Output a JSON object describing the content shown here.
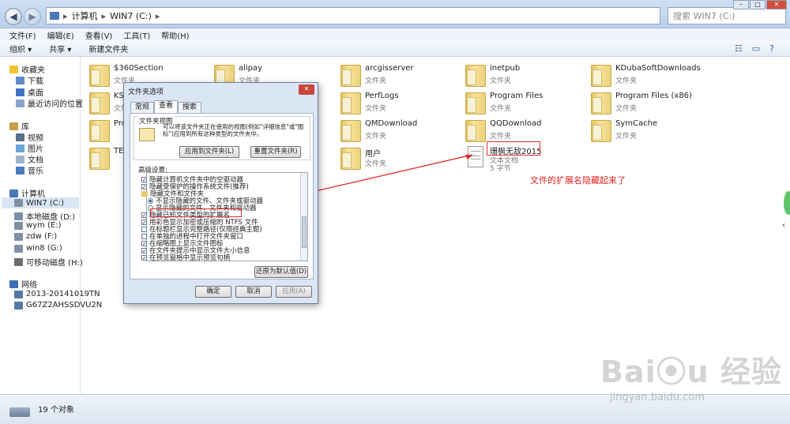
{
  "window": {
    "breadcrumb": [
      "计算机",
      "WIN7 (C:)"
    ],
    "search_placeholder": "搜索 WIN7 (C:)"
  },
  "menubar": [
    "文件(F)",
    "编辑(E)",
    "查看(V)",
    "工具(T)",
    "帮助(H)"
  ],
  "toolbar": {
    "organize": "组织 ▾",
    "share": "共享 ▾",
    "new_folder": "新建文件夹"
  },
  "sidebar": {
    "favorites": {
      "label": "收藏夹",
      "items": [
        "下载",
        "桌面",
        "最近访问的位置"
      ]
    },
    "libraries": {
      "label": "库",
      "items": [
        "视频",
        "图片",
        "文档",
        "音乐"
      ]
    },
    "computer": {
      "label": "计算机",
      "items": [
        "WIN7 (C:)",
        "本地磁盘 (D:)",
        "wym (E:)",
        "zdw (F:)",
        "win8 (G:)",
        "可移动磁盘 (H:)"
      ]
    },
    "network": {
      "label": "网络",
      "items": [
        "2013-20141019TN",
        "G67Z2AHSSDVU2N"
      ]
    }
  },
  "files": [
    {
      "name": "$360Section",
      "type": "文件夹"
    },
    {
      "name": "alipay",
      "type": "文件夹"
    },
    {
      "name": "arcgisserver",
      "type": "文件夹"
    },
    {
      "name": "inetpub",
      "type": "文件夹"
    },
    {
      "name": "KDubaSoftDownloads",
      "type": "文件夹"
    },
    {
      "name": "KS",
      "type": "文件夹"
    },
    {
      "name": "PerfLogs",
      "type": "文件夹"
    },
    {
      "name": "Program Files",
      "type": "文件夹"
    },
    {
      "name": "Program Files (x86)",
      "type": "文件夹"
    },
    {
      "name": "Pro",
      "type": "文件夹"
    },
    {
      "name": "QMDownload",
      "type": "文件夹"
    },
    {
      "name": "QQDownload",
      "type": "文件夹"
    },
    {
      "name": "SymCache",
      "type": "文件夹"
    },
    {
      "name": "TE",
      "type": "文件夹"
    },
    {
      "name": "用户",
      "type": "文件夹"
    },
    {
      "name": "珊枫无敌2015",
      "type": "文本文档",
      "size": "5 字节"
    }
  ],
  "status": {
    "count": "19 个对象"
  },
  "annotation": {
    "text": "文件的扩展名隐藏起来了",
    "color": "#e02020"
  },
  "dialog": {
    "title": "文件夹选项",
    "tabs": [
      "常规",
      "查看",
      "搜索"
    ],
    "folder_views": {
      "label": "文件夹视图",
      "desc": "可以将该文件夹正在使用的视图(例如\"详细信息\"或\"图标\")应用到所有这种类型的文件夹中。",
      "apply_btn": "应用到文件夹(L)",
      "reset_btn": "重置文件夹(R)"
    },
    "advanced_label": "高级设置:",
    "options": [
      {
        "text": "隐藏计算机文件夹中的空驱动器",
        "kind": "cb",
        "checked": true
      },
      {
        "text": "隐藏受保护的操作系统文件(推荐)",
        "kind": "cb",
        "checked": true
      },
      {
        "text": "隐藏文件和文件夹",
        "kind": "folder"
      },
      {
        "text": "不显示隐藏的文件、文件夹或驱动器",
        "kind": "rb",
        "checked": true
      },
      {
        "text": "显示隐藏的文件、文件夹和驱动器",
        "kind": "rb",
        "checked": false
      },
      {
        "text": "隐藏已知文件类型的扩展名",
        "kind": "cb",
        "checked": true
      },
      {
        "text": "用彩色显示加密或压缩的 NTFS 文件",
        "kind": "cb",
        "checked": true
      },
      {
        "text": "在标题栏显示完整路径(仅限经典主题)",
        "kind": "cb",
        "checked": false
      },
      {
        "text": "在单独的进程中打开文件夹窗口",
        "kind": "cb",
        "checked": false
      },
      {
        "text": "在缩略图上显示文件图标",
        "kind": "cb",
        "checked": true
      },
      {
        "text": "在文件夹提示中显示文件大小信息",
        "kind": "cb",
        "checked": true
      },
      {
        "text": "在预览窗格中显示预览句柄",
        "kind": "cb",
        "checked": true
      }
    ],
    "restore_btn": "还原为默认值(D)",
    "ok": "确定",
    "cancel": "取消",
    "apply": "应用(A)"
  },
  "watermark": {
    "text": "jingyan.baidu.com"
  }
}
